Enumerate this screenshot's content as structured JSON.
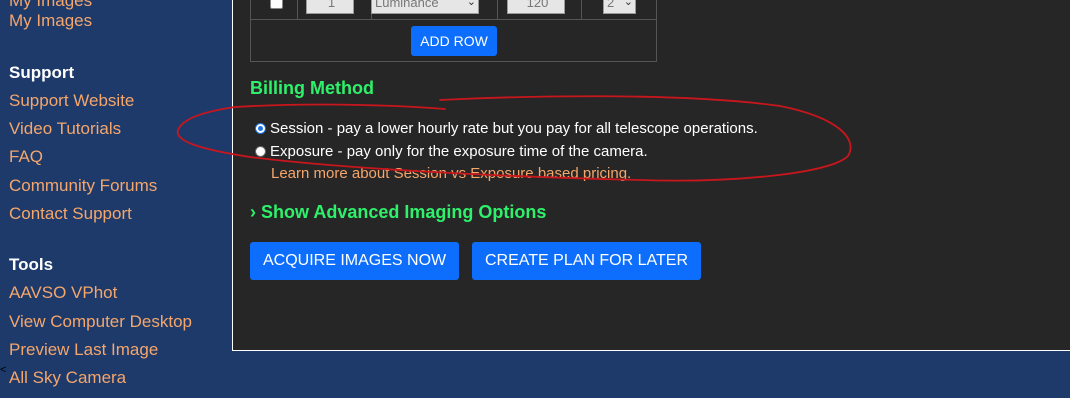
{
  "sidebar": {
    "top_partial": "My Images",
    "top_link": "My Images",
    "support_heading": "Support",
    "support_links": [
      "Support Website",
      "Video Tutorials",
      "FAQ",
      "Community Forums",
      "Contact Support"
    ],
    "tools_heading": "Tools",
    "tools_links": [
      "AAVSO VPhot",
      "View Computer Desktop",
      "Preview Last Image",
      "All Sky Camera"
    ]
  },
  "filter_table": {
    "exposure_count": "1",
    "filter_value": "Luminance",
    "exposure_seconds": "120",
    "binning": "2",
    "add_row_label": "ADD ROW"
  },
  "billing": {
    "title": "Billing Method",
    "options": [
      {
        "label": "Session - pay a lower hourly rate but you pay for all telescope operations.",
        "selected": true
      },
      {
        "label": "Exposure - pay only for the exposure time of the camera.",
        "selected": false
      }
    ],
    "learn_more": "Learn more about Session vs Exposure based pricing."
  },
  "advanced": {
    "caret": "›",
    "label": "Show Advanced Imaging Options"
  },
  "actions": {
    "acquire_label": "ACQUIRE IMAGES NOW",
    "plan_label": "CREATE PLAN FOR LATER"
  },
  "colors": {
    "sidebar_bg": "#1d3a6b",
    "link": "#f5a66b",
    "heading_green": "#2ff06a",
    "button_blue": "#0d6efd",
    "panel_bg": "#262626",
    "annotation_red": "#c8161d"
  }
}
